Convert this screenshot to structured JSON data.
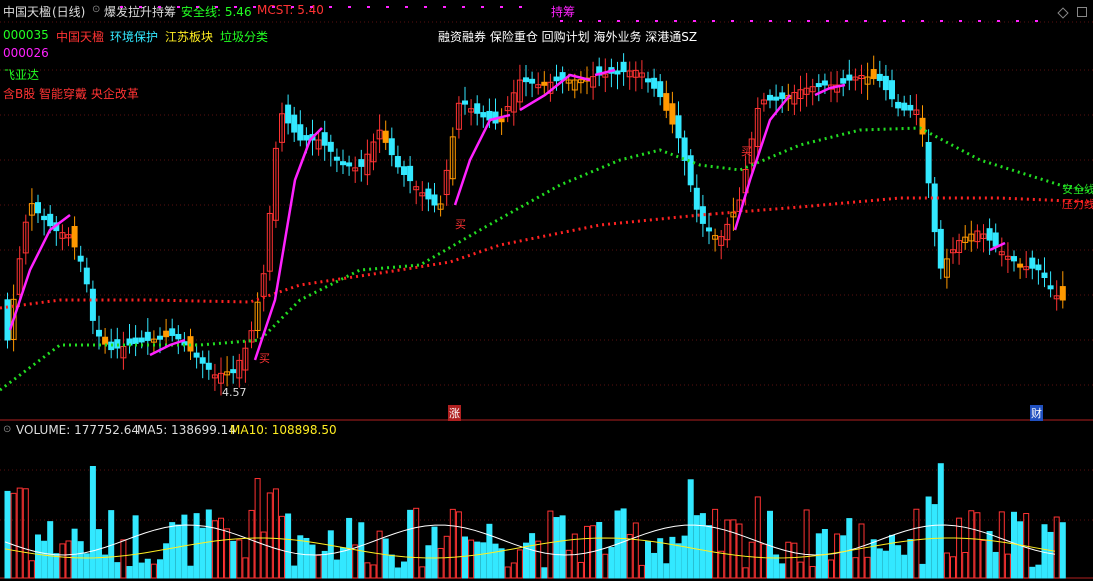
{
  "header": {
    "stock_name": "中国天楹",
    "period": "(日线)",
    "indicator_name": "爆发拉升持筹",
    "safe_line_label": "安全线: 5.46",
    "mcst_label": "MCST: 5.40",
    "holding_label": "持筹"
  },
  "concepts": {
    "code1": "000035",
    "name1": "中国天楹",
    "tag1": "环境保护",
    "tag2": "江苏板块",
    "tag3": "垃圾分类",
    "code2": "000026",
    "name2": "飞亚达",
    "line3": "含B股 智能穿戴 央企改革",
    "center_tags": "融资融券 保险重仓 回购计划 海外业务 深港通SZ"
  },
  "chart_labels": {
    "buy1": "买",
    "buy2": "买",
    "buy3": "买",
    "low_price": "4.57",
    "safe_line": "安全线",
    "pressure_line": "压力线",
    "zhang_badge": "涨",
    "cai_badge": "财"
  },
  "volume": {
    "label": "VOLUME: 177752.64",
    "ma5": "MA5: 138699.14",
    "ma10": "MA10: 108898.50"
  },
  "colors": {
    "up": "#ff3333",
    "down": "#33e8ff",
    "safe": "#22dd22",
    "pressure": "#ff2222",
    "magenta": "#ff22ff",
    "yellow": "#ffee22",
    "orange": "#ff9900"
  }
}
